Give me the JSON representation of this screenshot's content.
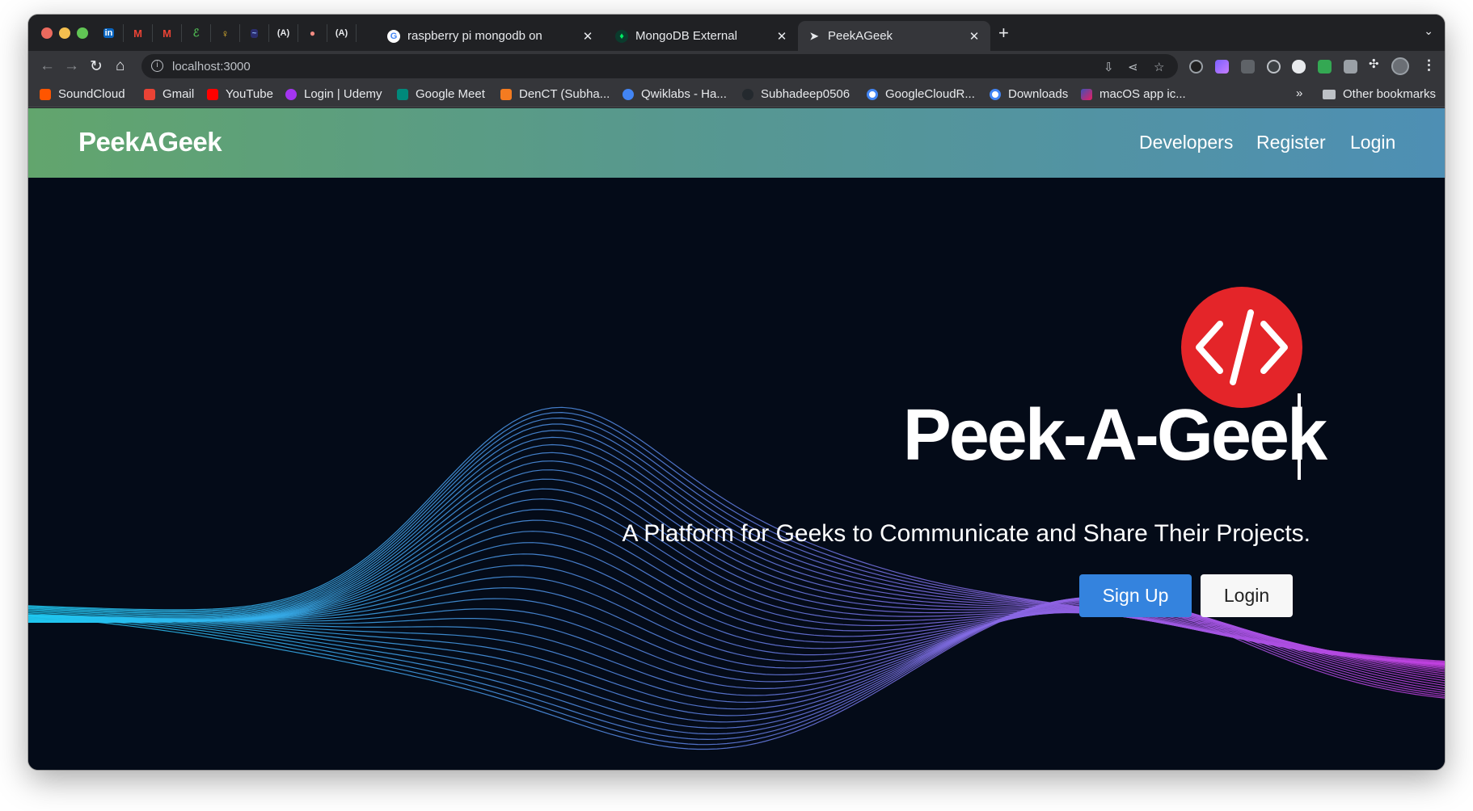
{
  "browser": {
    "tabs": [
      {
        "title": "raspberry pi mongodb on",
        "close": "✕"
      },
      {
        "title": "MongoDB External",
        "close": "✕"
      },
      {
        "title": "PeekAGeek",
        "close": "✕",
        "active": true
      }
    ],
    "new_tab": "+",
    "tab_menu": "⌄",
    "url": "localhost:3000",
    "bookmarks": [
      {
        "label": "SoundCloud",
        "color": "#ff5500"
      },
      {
        "label": "Gmail",
        "color": "#ea4335"
      },
      {
        "label": "YouTube",
        "color": "#ff0000"
      },
      {
        "label": "Login | Udemy",
        "color": "#a435f0"
      },
      {
        "label": "Google Meet",
        "color": "#00897b"
      },
      {
        "label": "DenCT (Subha...",
        "color": "#f47b20"
      },
      {
        "label": "Qwiklabs - Ha...",
        "color": "#4285f4"
      },
      {
        "label": "Subhadeep0506",
        "color": "#24292e"
      },
      {
        "label": "GoogleCloudR...",
        "color": "#4285f4"
      },
      {
        "label": "Downloads",
        "color": "#4285f4"
      },
      {
        "label": "macOS app ic...",
        "color": "#c2185b"
      }
    ],
    "bookmarks_more": "»",
    "other_bookmarks": "Other bookmarks"
  },
  "site": {
    "brand": "PeekAGeek",
    "nav": [
      "Developers",
      "Register",
      "Login"
    ],
    "hero_title": "Peek-A-Geek",
    "hero_subtitle": "A Platform for Geeks to Communicate and Share Their Projects.",
    "signup_label": "Sign Up",
    "login_label": "Login"
  },
  "colors": {
    "logo_red": "#e42529",
    "signup_blue": "#3483de",
    "navbar_gradient": [
      "#62a56d",
      "#4e8fb4"
    ],
    "wave_start": "#1ec8f0",
    "wave_end": "#c23fe0"
  }
}
